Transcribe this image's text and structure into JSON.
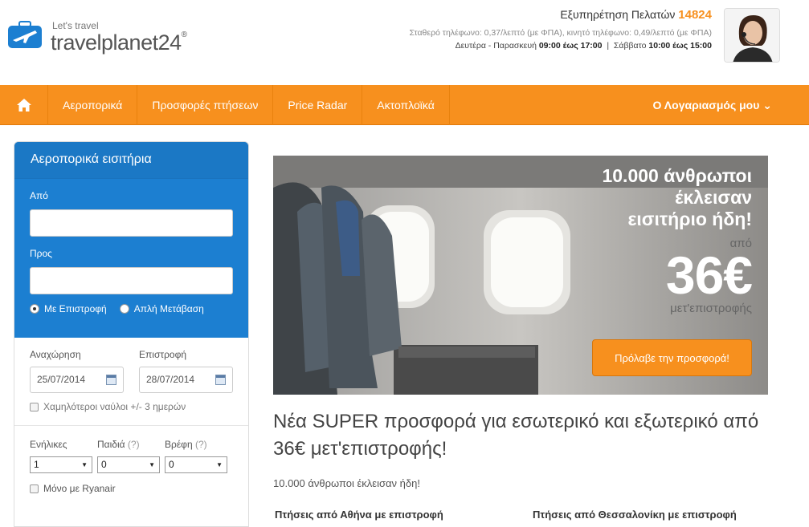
{
  "header": {
    "tagline": "Let's travel",
    "brand": "travelplanet24",
    "brand_reg": "®",
    "support_title": "Εξυπηρέτηση Πελατών",
    "support_phone": "14824",
    "support_costs": "Σταθερό τηλέφωνο: 0,37/λεπτό (με ΦΠΑ), κινητό τηλέφωνο: 0,49/λεπτό (με ΦΠΑ)",
    "hours_weekdays_label": "Δευτέρα - Παρασκευή",
    "hours_weekdays": "09:00 έως 17:00",
    "hours_sep": "|",
    "hours_saturday_label": "Σάββατο",
    "hours_saturday": "10:00 έως 15:00"
  },
  "nav": {
    "items": [
      "Αεροπορικά",
      "Προσφορές πτήσεων",
      "Price Radar",
      "Ακτοπλοϊκά"
    ],
    "account": "Ο Λογαριασμός μου ⌄"
  },
  "search": {
    "title": "Αεροπορικά εισιτήρια",
    "from_label": "Από",
    "to_label": "Προς",
    "from_value": "",
    "to_value": "",
    "trip_return": "Με Επιστροφή",
    "trip_oneway": "Απλή Μετάβαση",
    "depart_label": "Αναχώρηση",
    "return_label": "Επιστροφή",
    "depart_value": "25/07/2014",
    "return_value": "28/07/2014",
    "flex_label": "Χαμηλότεροι ναύλοι +/- 3 ημερών",
    "adults_label": "Ενήλικες",
    "children_label": "Παιδιά",
    "infants_label": "Βρέφη",
    "help": "(?)",
    "adults_value": "1",
    "children_value": "0",
    "infants_value": "0",
    "ryanair_label": "Μόνο με Ryanair"
  },
  "banner": {
    "line1": "10.000 άνθρωποι",
    "line2": "έκλεισαν",
    "line3": "εισιτήριο ήδη!",
    "from": "από",
    "price": "36€",
    "per": "μετ'επιστροφής",
    "cta": "Πρόλαβε την προσφορά!"
  },
  "main": {
    "headline": "Νέα SUPER προσφορά για εσωτερικό και εξωτερικό από 36€ μετ'επιστροφής!",
    "subline": "10.000 άνθρωποι έκλεισαν ήδη!",
    "col1": "Πτήσεις από Αθήνα με επιστροφή",
    "col2": "Πτήσεις από Θεσσαλονίκη με επιστροφή"
  },
  "colors": {
    "accent": "#f7901e",
    "panel_blue": "#1c7fd1"
  }
}
